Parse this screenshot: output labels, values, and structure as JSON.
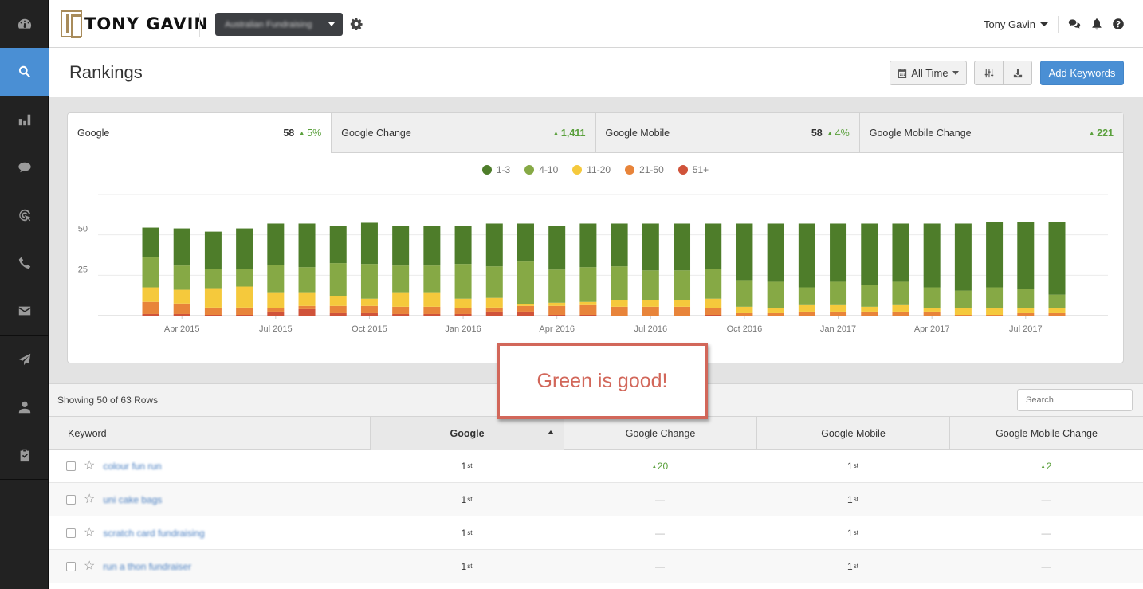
{
  "sidebar": {
    "items": [
      {
        "name": "dashboard",
        "icon": "dashboard-icon",
        "active": false
      },
      {
        "name": "rankings",
        "icon": "search-icon",
        "active": true
      },
      {
        "name": "analytics",
        "icon": "bar-chart-icon",
        "active": false
      },
      {
        "name": "reviews",
        "icon": "chat-bubble-icon",
        "active": false
      },
      {
        "name": "targeting",
        "icon": "target-icon",
        "active": false
      },
      {
        "name": "calls",
        "icon": "phone-icon",
        "active": false
      },
      {
        "name": "email",
        "icon": "envelope-icon",
        "active": false
      },
      {
        "name": "campaigns",
        "icon": "paper-plane-icon",
        "active": false
      },
      {
        "name": "contacts",
        "icon": "user-icon",
        "active": false
      },
      {
        "name": "tasks",
        "icon": "clipboard-check-icon",
        "active": false
      }
    ]
  },
  "header": {
    "logo_text": "TONY GAVIN",
    "account_selector": "Australian Fundraising",
    "user_name": "Tony Gavin"
  },
  "page": {
    "title": "Rankings",
    "date_range": "All Time",
    "add_keywords": "Add Keywords"
  },
  "tabs": [
    {
      "label": "Google",
      "value": "58",
      "change": "5%",
      "active": true
    },
    {
      "label": "Google Change",
      "value": "",
      "change": "1,411",
      "active": false
    },
    {
      "label": "Google Mobile",
      "value": "58",
      "change": "4%",
      "active": false
    },
    {
      "label": "Google Mobile Change",
      "value": "",
      "change": "221",
      "active": false
    }
  ],
  "colors": {
    "r1_3": "#4e7d2a",
    "r4_10": "#86a945",
    "r11_20": "#f5c93c",
    "r21_50": "#e8843a",
    "r51p": "#d0533a",
    "accent": "#4a8fd4",
    "up": "#5aa03c"
  },
  "chart_data": {
    "type": "bar",
    "stacked": true,
    "title": "",
    "xlabel": "",
    "ylabel": "",
    "ylim": [
      0,
      75
    ],
    "yticks": [
      25,
      50
    ],
    "grid": true,
    "legend_position": "top-center",
    "categories": [
      "Mar 2015",
      "Apr 2015",
      "May 2015",
      "Jun 2015",
      "Jul 2015",
      "Aug 2015",
      "Sep 2015",
      "Oct 2015",
      "Nov 2015",
      "Dec 2015",
      "Jan 2016",
      "Feb 2016",
      "Mar 2016",
      "Apr 2016",
      "May 2016",
      "Jun 2016",
      "Jul 2016",
      "Aug 2016",
      "Sep 2016",
      "Oct 2016",
      "Nov 2016",
      "Dec 2016",
      "Jan 2017",
      "Feb 2017",
      "Mar 2017",
      "Apr 2017",
      "May 2017",
      "Jun 2017",
      "Jul 2017",
      "Aug 2017"
    ],
    "xtick_labels": [
      "Apr 2015",
      "Jul 2015",
      "Oct 2015",
      "Jan 2016",
      "Apr 2016",
      "Jul 2016",
      "Oct 2016",
      "Jan 2017",
      "Apr 2017",
      "Jul 2017"
    ],
    "series": [
      {
        "name": "51+",
        "values": [
          1,
          1,
          0.5,
          0.5,
          2.5,
          4,
          1.5,
          1.5,
          1,
          1,
          1,
          2.5,
          2.5,
          0.5,
          0.5,
          0,
          0,
          0,
          0.5,
          0,
          0,
          0,
          0,
          0,
          0,
          0,
          0,
          0,
          0,
          0
        ]
      },
      {
        "name": "21-50",
        "values": [
          7.5,
          6.5,
          4.5,
          4.5,
          2,
          2,
          4.5,
          4.5,
          4.5,
          4.5,
          3.5,
          2.5,
          3.5,
          5.5,
          6,
          5.5,
          5.5,
          5.5,
          4,
          1.5,
          1.5,
          2.5,
          2.5,
          2.5,
          2.5,
          2.5,
          0.5,
          0.5,
          1.5,
          1.5
        ]
      },
      {
        "name": "11-20",
        "values": [
          9,
          8.5,
          12,
          13,
          10,
          8.5,
          6,
          4.5,
          9,
          9,
          6,
          6,
          1,
          2,
          2,
          4,
          4,
          4,
          6,
          4,
          3,
          4,
          4,
          3,
          4,
          2,
          4,
          4,
          3,
          3
        ]
      },
      {
        "name": "4-10",
        "values": [
          18.5,
          15,
          12,
          11,
          17,
          15.5,
          20.5,
          21.5,
          16.5,
          16.5,
          21.5,
          19.5,
          26.5,
          20.5,
          21.5,
          21,
          18.5,
          18.5,
          18.5,
          16.5,
          16.5,
          11,
          14.5,
          13.5,
          14.5,
          13,
          11,
          13,
          12,
          8.5
        ]
      },
      {
        "name": "1-3",
        "values": [
          18.5,
          23,
          23,
          25,
          25.5,
          27,
          23,
          25.5,
          24.5,
          24.5,
          23.5,
          26.5,
          23.5,
          27,
          27,
          26.5,
          29,
          29,
          28,
          35,
          36,
          39.5,
          36,
          38,
          36,
          39.5,
          41.5,
          40.5,
          41.5,
          45
        ]
      }
    ],
    "legend": [
      "1-3",
      "4-10",
      "11-20",
      "21-50",
      "51+"
    ]
  },
  "annotation": {
    "text": "Green is good!"
  },
  "table": {
    "showing": "Showing 50 of 63 Rows",
    "search_placeholder": "Search",
    "columns": [
      "Keyword",
      "Google",
      "Google Change",
      "Google Mobile",
      "Google Mobile Change"
    ],
    "sorted_column": "Google",
    "rows": [
      {
        "keyword": "colour fun run",
        "google": "1",
        "google_sup": "st",
        "google_change": "20",
        "mobile": "1",
        "mobile_sup": "st",
        "mobile_change": "2"
      },
      {
        "keyword": "uni cake bags",
        "google": "1",
        "google_sup": "st",
        "google_change": "—",
        "mobile": "1",
        "mobile_sup": "st",
        "mobile_change": "—"
      },
      {
        "keyword": "scratch card fundraising",
        "google": "1",
        "google_sup": "st",
        "google_change": "—",
        "mobile": "1",
        "mobile_sup": "st",
        "mobile_change": "—"
      },
      {
        "keyword": "run a thon fundraiser",
        "google": "1",
        "google_sup": "st",
        "google_change": "—",
        "mobile": "1",
        "mobile_sup": "st",
        "mobile_change": "—"
      }
    ]
  }
}
